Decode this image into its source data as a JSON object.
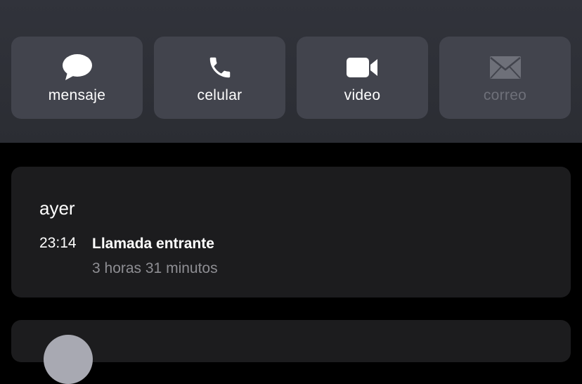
{
  "actions": [
    {
      "label": "mensaje",
      "icon": "message-bubble-icon",
      "enabled": true
    },
    {
      "label": "celular",
      "icon": "phone-icon",
      "enabled": true
    },
    {
      "label": "video",
      "icon": "video-camera-icon",
      "enabled": true
    },
    {
      "label": "correo",
      "icon": "mail-icon",
      "enabled": false
    }
  ],
  "call_history": {
    "day": "ayer",
    "entries": [
      {
        "time": "23:14",
        "type": "Llamada entrante",
        "duration": "3 horas 31 minutos"
      }
    ]
  },
  "colors": {
    "header_bg": "#2e3037",
    "button_bg": "#42444d",
    "card_bg": "#1c1c1e",
    "disabled_text": "#6e7079",
    "secondary_text": "#8e8e93"
  }
}
